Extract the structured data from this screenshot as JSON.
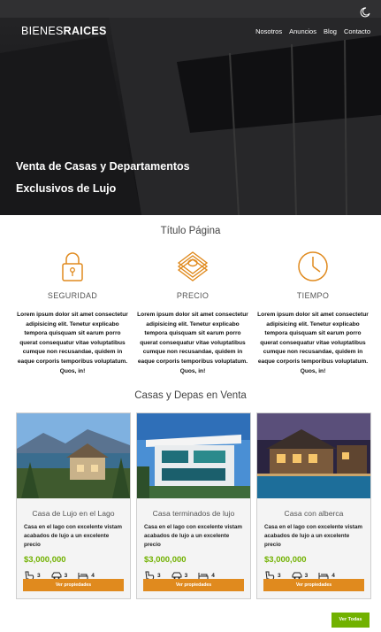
{
  "header": {
    "brand_light": "BIENES",
    "brand_bold": "RAICES",
    "theme_icon": "moon-icon",
    "nav": [
      "Nosotros",
      "Anuncios",
      "Blog",
      "Contacto"
    ],
    "hero_title_line1": "Venta de Casas y Departamentos",
    "hero_title_line2": "Exclusivos de Lujo"
  },
  "features_section": {
    "title": "Título Página",
    "items": [
      {
        "icon": "lock-icon",
        "title": "SEGURIDAD",
        "text": "Lorem ipsum dolor sit amet consectetur adipisicing elit. Tenetur explicabo tempora quisquam sit earum porro querat consequatur vitae voluptatibus cumque non recusandae, quidem in eaque corporis temporibus voluptatum. Quos, in!"
      },
      {
        "icon": "money-icon",
        "title": "PRECIO",
        "text": "Lorem ipsum dolor sit amet consectetur adipisicing elit. Tenetur explicabo tempora quisquam sit earum porro querat consequatur vitae voluptatibus cumque non recusandae, quidem in eaque corporis temporibus voluptatum. Quos, in!"
      },
      {
        "icon": "clock-icon",
        "title": "TIEMPO",
        "text": "Lorem ipsum dolor sit amet consectetur adipisicing elit. Tenetur explicabo tempora quisquam sit earum porro querat consequatur vitae voluptatibus cumque non recusandae, quidem in eaque corporis temporibus voluptatum. Quos, in!"
      }
    ]
  },
  "listings": {
    "title": "Casas y Depas en Venta",
    "cards": [
      {
        "title": "Casa de Lujo en el Lago",
        "desc": "Casa en el lago con excelente vistam acabados de lujo a un excelente precio",
        "price": "$3,000,000",
        "wc": "3",
        "parking": "3",
        "rooms": "4",
        "button": "Ver propiedades"
      },
      {
        "title": "Casa terminados de lujo",
        "desc": "Casa en el lago con excelente vistam acabados de lujo a un excelente precio",
        "price": "$3,000,000",
        "wc": "3",
        "parking": "3",
        "rooms": "4",
        "button": "Ver propiedades"
      },
      {
        "title": "Casa con alberca",
        "desc": "Casa en el lago con excelente vistam acabados de lujo a un excelente precio",
        "price": "$3,000,000",
        "wc": "3",
        "parking": "3",
        "rooms": "4",
        "button": "Ver propiedades"
      }
    ],
    "view_all": "Ver Todas"
  },
  "colors": {
    "accent_orange": "#e08a1e",
    "accent_green": "#71b100",
    "hero_dark": "#2a2a2d"
  }
}
